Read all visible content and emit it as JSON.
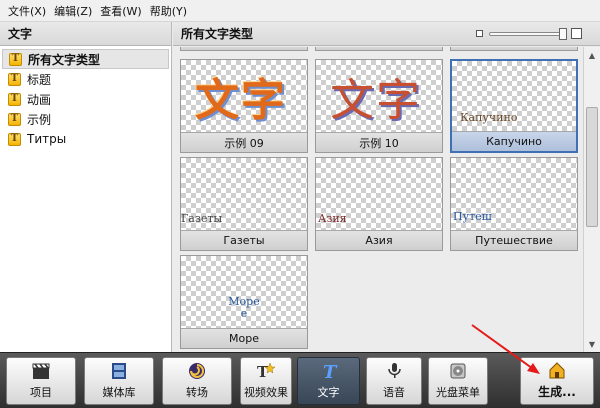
{
  "menu": [
    "文件(X)",
    "编辑(Z)",
    "查看(W)",
    "帮助(Y)"
  ],
  "left": {
    "title": "文字",
    "items": [
      {
        "label": "所有文字类型",
        "selected": true
      },
      {
        "label": "标题",
        "selected": false
      },
      {
        "label": "动画",
        "selected": false
      },
      {
        "label": "示例",
        "selected": false
      },
      {
        "label": "Титры",
        "selected": false
      }
    ]
  },
  "right": {
    "title": "所有文字类型",
    "tiles": [
      {
        "label": "示例 09",
        "preview": "文字"
      },
      {
        "label": "示例 10",
        "preview": "文字"
      },
      {
        "label": "Капучино",
        "preview": "Капучино",
        "selected": true
      },
      {
        "label": "Газеты",
        "preview": "Газеты"
      },
      {
        "label": "Азия",
        "preview": "Азия"
      },
      {
        "label": "Путешествие",
        "preview": "Путеш"
      },
      {
        "label": "Море",
        "preview": "Море\nе"
      }
    ]
  },
  "toolbar": {
    "buttons": [
      {
        "label": "项目",
        "icon": "clapper-icon"
      },
      {
        "label": "媒体库",
        "icon": "film-strip-icon"
      },
      {
        "label": "转场",
        "icon": "swirl-icon"
      },
      {
        "label": "视频效果",
        "icon": "star-effect-icon"
      },
      {
        "label": "文字",
        "icon": "text-t-icon",
        "active": true
      },
      {
        "label": "语音",
        "icon": "microphone-icon"
      },
      {
        "label": "光盘菜单",
        "icon": "disc-menu-icon"
      },
      {
        "label": "生成...",
        "icon": "generate-icon"
      }
    ]
  },
  "colors": {
    "accent": "#3f6fb5",
    "toolbar_bg": "#3a3a3a",
    "annotation_arrow": "#e31b1b"
  }
}
